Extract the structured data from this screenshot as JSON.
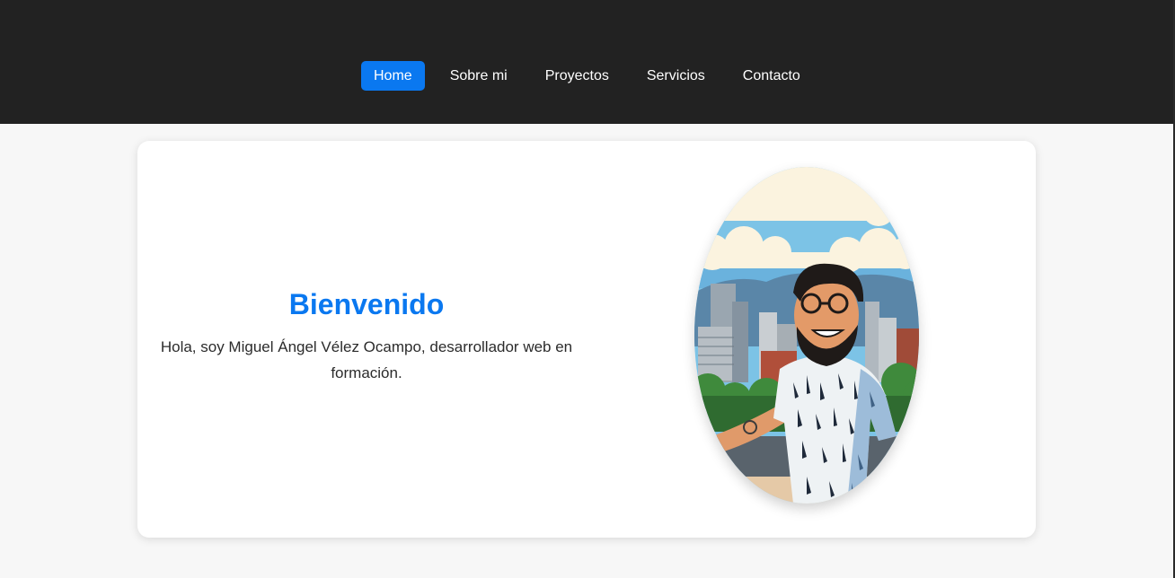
{
  "nav": {
    "items": [
      {
        "label": "Home",
        "active": true
      },
      {
        "label": "Sobre mi",
        "active": false
      },
      {
        "label": "Proyectos",
        "active": false
      },
      {
        "label": "Servicios",
        "active": false
      },
      {
        "label": "Contacto",
        "active": false
      }
    ]
  },
  "hero": {
    "title": "Bienvenido",
    "subtitle": "Hola, soy Miguel Ángel Vélez Ocampo, desarrollador web en formación."
  },
  "colors": {
    "accent": "#0a78f0",
    "header_bg": "#222222",
    "page_bg": "#f7f7f7"
  },
  "portrait": {
    "icon": "illustrated-avatar"
  }
}
